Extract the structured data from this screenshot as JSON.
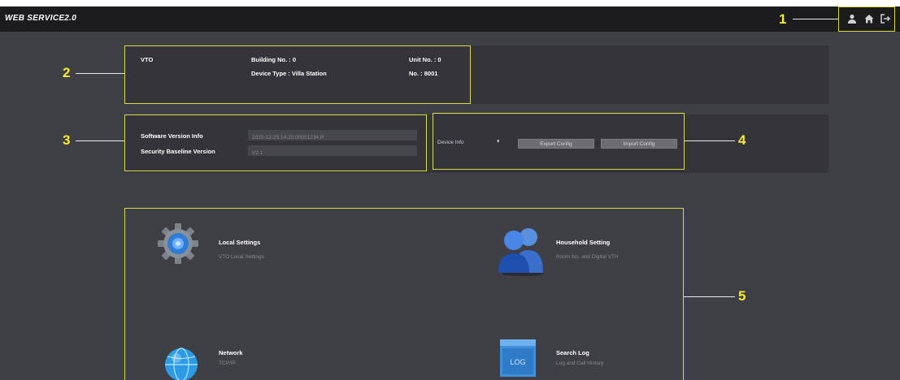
{
  "app": {
    "title": "WEB SERVICE2.0"
  },
  "callouts": [
    "1",
    "2",
    "3",
    "4",
    "5"
  ],
  "header_icons": [
    "user-icon",
    "home-icon",
    "logout-icon"
  ],
  "device": {
    "type": "VTO",
    "building": "Building No. : 0",
    "device_type": "Device Type : Villa Station",
    "unit": "Unit No. : 0",
    "number": "No. : 8001"
  },
  "version": {
    "software_label": "Software Version Info",
    "software_value": "2020-12-25 14:20:00001234.R",
    "baseline_label": "Security Baseline Version",
    "baseline_value": "V2.1"
  },
  "config": {
    "select_value": "Device Info",
    "export_label": "Export Config",
    "import_label": "Import Config"
  },
  "modules": [
    {
      "name": "Local Settings",
      "desc": "VTO Local Settings",
      "icon": "gear-icon"
    },
    {
      "name": "Household Setting",
      "desc": "Room No. and Digital VTH",
      "icon": "users-icon"
    },
    {
      "name": "Network",
      "desc": "TCP/IP",
      "icon": "globe-icon"
    },
    {
      "name": "Search Log",
      "desc": "Log and Call History",
      "icon": "log-icon"
    }
  ],
  "log_icon_text": "LOG",
  "colors": {
    "highlight": "#d8dc4a",
    "callout": "#f4ee2e",
    "background": "#3f3f46",
    "panel": "#34343a"
  }
}
